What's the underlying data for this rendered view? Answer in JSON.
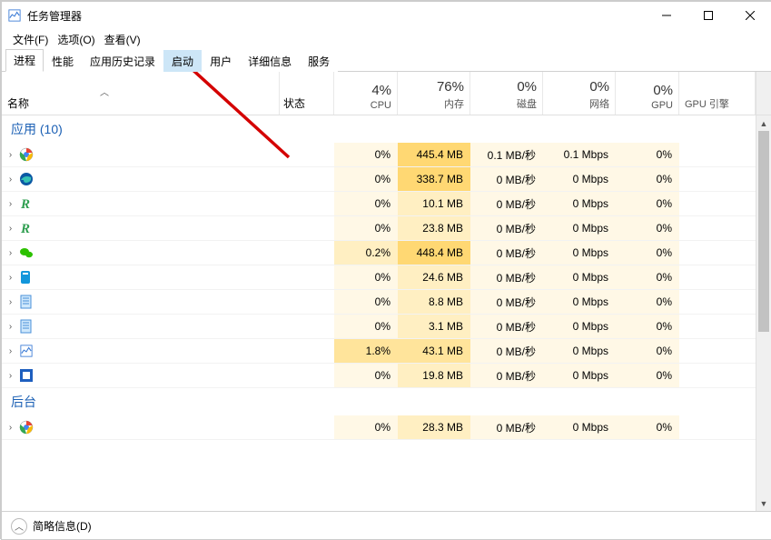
{
  "window": {
    "title": "任务管理器"
  },
  "menu": {
    "file": "文件(F)",
    "options": "选项(O)",
    "view": "查看(V)"
  },
  "tabs": {
    "processes": "进程",
    "performance": "性能",
    "app_history": "应用历史记录",
    "startup": "启动",
    "users": "用户",
    "details": "详细信息",
    "services": "服务"
  },
  "headers": {
    "name": "名称",
    "status": "状态",
    "cpu_pct": "4%",
    "cpu_lbl": "CPU",
    "mem_pct": "76%",
    "mem_lbl": "内存",
    "disk_pct": "0%",
    "disk_lbl": "磁盘",
    "net_pct": "0%",
    "net_lbl": "网络",
    "gpu_pct": "0%",
    "gpu_lbl": "GPU",
    "gpu_engine": "GPU 引擎"
  },
  "groups": {
    "apps": "应用 (10)",
    "background": "后台"
  },
  "zero": {
    "mbps_sec": "0 MB/秒",
    "mbps": "0 Mbps",
    "pct": "0%"
  },
  "rows": [
    {
      "cpu": "0%",
      "mem": "445.4 MB",
      "disk": "0.1 MB/秒",
      "net": "0.1 Mbps",
      "gpu": "0%",
      "icon": "chrome"
    },
    {
      "cpu": "0%",
      "mem": "338.7 MB",
      "disk": "0 MB/秒",
      "net": "0 Mbps",
      "gpu": "0%",
      "icon": "edge"
    },
    {
      "cpu": "0%",
      "mem": "10.1 MB",
      "disk": "0 MB/秒",
      "net": "0 Mbps",
      "gpu": "0%",
      "icon": "r-green"
    },
    {
      "cpu": "0%",
      "mem": "23.8 MB",
      "disk": "0 MB/秒",
      "net": "0 Mbps",
      "gpu": "0%",
      "icon": "r-green"
    },
    {
      "cpu": "0.2%",
      "mem": "448.4 MB",
      "disk": "0 MB/秒",
      "net": "0 Mbps",
      "gpu": "0%",
      "icon": "wechat"
    },
    {
      "cpu": "0%",
      "mem": "24.6 MB",
      "disk": "0 MB/秒",
      "net": "0 Mbps",
      "gpu": "0%",
      "icon": "blue-app"
    },
    {
      "cpu": "0%",
      "mem": "8.8 MB",
      "disk": "0 MB/秒",
      "net": "0 Mbps",
      "gpu": "0%",
      "icon": "notepad"
    },
    {
      "cpu": "0%",
      "mem": "3.1 MB",
      "disk": "0 MB/秒",
      "net": "0 Mbps",
      "gpu": "0%",
      "icon": "notepad"
    },
    {
      "cpu": "1.8%",
      "mem": "43.1 MB",
      "disk": "0 MB/秒",
      "net": "0 Mbps",
      "gpu": "0%",
      "icon": "taskmgr"
    },
    {
      "cpu": "0%",
      "mem": "19.8 MB",
      "disk": "0 MB/秒",
      "net": "0 Mbps",
      "gpu": "0%",
      "icon": "blue-sq"
    }
  ],
  "bg_rows": [
    {
      "cpu": "0%",
      "mem": "28.3 MB",
      "disk": "0 MB/秒",
      "net": "0 Mbps",
      "gpu": "0%",
      "icon": "chrome"
    }
  ],
  "footer": {
    "fewer_details": "简略信息(D)"
  }
}
